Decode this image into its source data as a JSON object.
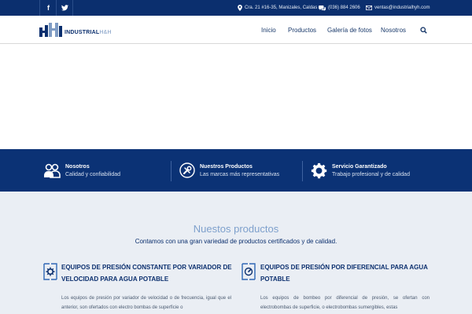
{
  "topbar": {
    "social": [
      "f",
      "t"
    ],
    "address": "Cra. 21 #16-35, Manizales, Caldas",
    "phone": "(036) 884 2606",
    "email": "ventas@industrialhyh.com"
  },
  "logo": {
    "brand": "INDUSTRIAL",
    "suffix": "H&H"
  },
  "nav": {
    "items": [
      "Inicio",
      "Productos",
      "Galería de fotos",
      "Nosotros"
    ]
  },
  "features": [
    {
      "title": "Nosotros",
      "subtitle": "Calidad y confiabilidad",
      "icon": "users-icon"
    },
    {
      "title": "Nuestros Productos",
      "subtitle": "Las marcas más representativas",
      "icon": "tools-icon"
    },
    {
      "title": "Servicio Garantizado",
      "subtitle": "Trabajo profesional y de calidad",
      "icon": "gear-icon"
    }
  ],
  "products": {
    "title": "Nuestos productos",
    "subtitle": "Contamos con una gran variedad de productos certificados y de calidad.",
    "cards": [
      {
        "title": "EQUIPOS DE PRESIÓN CONSTANTE POR VARIADOR DE VELOCIDAD PARA AGUA POTABLE",
        "text": "Los equipos de presión por variador de velocidad o de frecuencia, igual que el anterior, son ofertados con electro bombas de superficie o"
      },
      {
        "title": "EQUIPOS DE PRESIÓN POR DIFERENCIAL PARA AGUA POTABLE",
        "text": "Los equipos de bombeo por diferencial de presión, se ofertan con electrobombas de superficie, o electrobombas sumergibles, estas"
      }
    ]
  },
  "colors": {
    "navy": "#0b2f6e",
    "band": "#0b3275",
    "accent": "#7ea0cc",
    "section_bg": "#eaeef4"
  }
}
